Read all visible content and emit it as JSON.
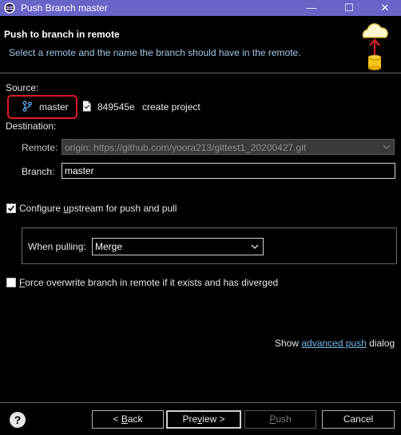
{
  "window": {
    "title": "Push Branch master",
    "minimize_glyph": "—",
    "maximize_glyph": "☐",
    "close_glyph": "✕"
  },
  "banner": {
    "title": "Push to branch in remote",
    "description": "Select a remote and the name the branch should have in the remote."
  },
  "source": {
    "label": "Source:",
    "branch_icon": "branch-icon",
    "branch": "master",
    "commit_icon": "commit-file-icon",
    "commit_id": "849545e",
    "commit_message": "create project"
  },
  "destination": {
    "label": "Destination:",
    "remote_label": "Remote:",
    "remote_value": "origin: https://github.com/yoora213/gittest1_20200427.git",
    "branch_label": "Branch:",
    "branch_value": "master"
  },
  "upstream": {
    "checked": true,
    "label_pre": "Configure ",
    "label_mn": "u",
    "label_post": "pstream for push and pull",
    "when_pulling_label": "When pulling:",
    "when_pulling_value": "Merge"
  },
  "force": {
    "checked": false,
    "label_mn": "F",
    "label_post": "orce overwrite branch in remote if it exists and has diverged"
  },
  "advanced": {
    "pre": "Show ",
    "link": "advanced push",
    "post": " dialog"
  },
  "buttons": {
    "help_glyph": "?",
    "back_pre": "< ",
    "back_mn": "B",
    "back_post": "ack",
    "preview_mn": "Pre",
    "preview_u": "v",
    "preview_post": "iew >",
    "push_mn": "P",
    "push_post": "ush",
    "cancel": "Cancel"
  },
  "colors": {
    "titlebar": "#6a63c8",
    "highlight": "#e01b24",
    "link": "#6fb7e8",
    "description": "#9fc6e6"
  }
}
